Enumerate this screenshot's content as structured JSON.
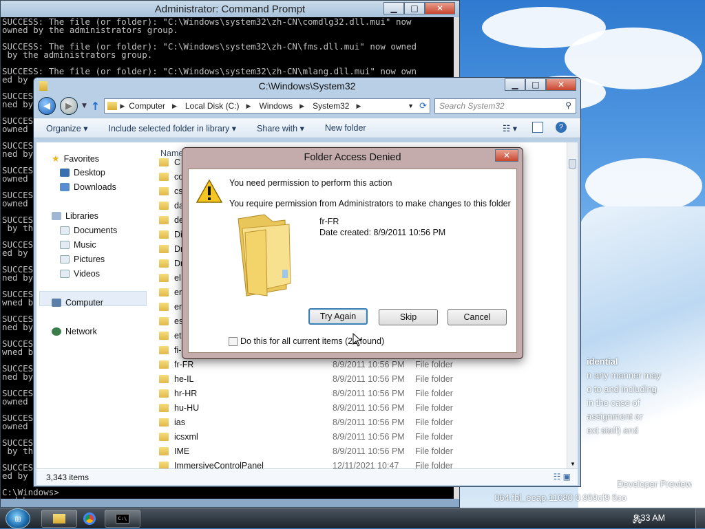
{
  "cmd": {
    "title": "Administrator: Command Prompt",
    "lines": [
      "SUCCESS: The file (or folder): \"C:\\Windows\\system32\\zh-CN\\comdlg32.dll.mui\" now",
      "owned by the administrators group.",
      "",
      "SUCCESS: The file (or folder): \"C:\\Windows\\system32\\zh-CN\\fms.dll.mui\" now owned",
      " by the administrators group.",
      "",
      "SUCCESS: The file (or folder): \"C:\\Windows\\system32\\zh-CN\\mlang.dll.mui\" now own",
      "ed by",
      "",
      "SUCCESS",
      "ned by",
      "",
      "SUCCESS",
      "owned b",
      "",
      "SUCCESS",
      "ned by",
      "",
      "SUCCESS",
      "owned",
      "",
      "SUCCESS",
      "owned",
      "",
      "SUCCESS",
      " by th",
      "",
      "SUCCESS",
      "ed by",
      "",
      "SUCCESS",
      "ned by",
      "",
      "SUCCESS",
      "wned b",
      "",
      "SUCCESS",
      "ned by",
      "",
      "SUCCESS",
      "wned b",
      "",
      "SUCCESS",
      "ned by",
      "",
      "SUCCESS",
      "owned",
      "",
      "SUCCESS",
      "owned",
      "",
      "SUCCESS",
      " by th",
      "",
      "SUCCESS",
      "ed by",
      "",
      "SUCCESS",
      "ned by",
      "",
      "SUCCESS",
      "wned b"
    ],
    "prompt": "C:\\Windows>"
  },
  "explorer": {
    "title": "C:\\Windows\\System32",
    "breadcrumb": [
      "Computer",
      "Local Disk (C:)",
      "Windows",
      "System32"
    ],
    "search_placeholder": "Search System32",
    "toolbar": {
      "organize": "Organize",
      "include": "Include selected folder in library",
      "share": "Share with",
      "new_folder": "New folder"
    },
    "nav": {
      "favorites": "Favorites",
      "desktop": "Desktop",
      "downloads": "Downloads",
      "libraries": "Libraries",
      "documents": "Documents",
      "music": "Music",
      "pictures": "Pictures",
      "videos": "Videos",
      "computer": "Computer",
      "network": "Network"
    },
    "column_name": "Name",
    "partial_rows": [
      "C",
      "co",
      "cs",
      "da",
      "de",
      "Di",
      "Dr",
      "Dr",
      "el",
      "en",
      "en",
      "es",
      "et",
      "fi-"
    ],
    "rows": [
      {
        "name": "fr-FR",
        "date": "8/9/2011 10:56 PM",
        "type": "File folder"
      },
      {
        "name": "he-IL",
        "date": "8/9/2011 10:56 PM",
        "type": "File folder"
      },
      {
        "name": "hr-HR",
        "date": "8/9/2011 10:56 PM",
        "type": "File folder"
      },
      {
        "name": "hu-HU",
        "date": "8/9/2011 10:56 PM",
        "type": "File folder"
      },
      {
        "name": "ias",
        "date": "8/9/2011 10:56 PM",
        "type": "File folder"
      },
      {
        "name": "icsxml",
        "date": "8/9/2011 10:56 PM",
        "type": "File folder"
      },
      {
        "name": "IME",
        "date": "8/9/2011 10:56 PM",
        "type": "File folder"
      },
      {
        "name": "ImmersiveControlPanel",
        "date": "12/11/2021 10:47",
        "type": "File folder"
      }
    ],
    "status": "3,343 items"
  },
  "dialog": {
    "title": "Folder Access Denied",
    "heading": "You need permission to perform this action",
    "message": "You require permission from Administrators to make changes to this folder",
    "folder_name": "fr-FR",
    "date_created": "Date created: 8/9/2011 10:56 PM",
    "try_again": "Try Again",
    "skip": "Skip",
    "cancel": "Cancel",
    "checkbox_label": "Do this for all current items (21 found)"
  },
  "desktop": {
    "watermark_lines": [
      "idential",
      "n any manner may",
      "o to and including",
      "in the case of",
      "assignment or",
      "ext staff) and"
    ],
    "watermark_build": "Developer Preview",
    "watermark_id": "064.fbl_eeap.11080  0.959cf9  5co"
  },
  "taskbar": {
    "clock": "9:33 AM"
  }
}
